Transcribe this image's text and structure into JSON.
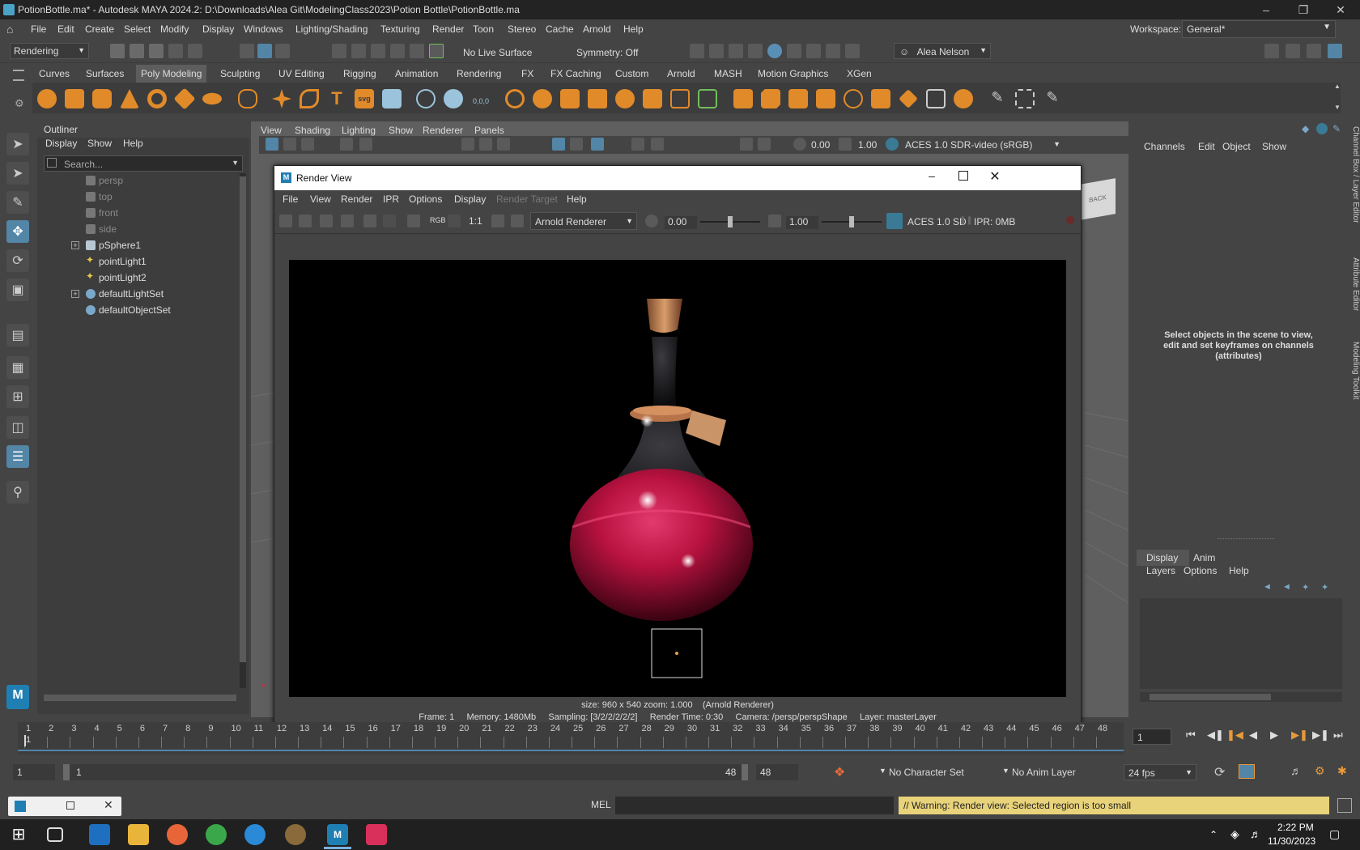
{
  "window": {
    "title": "PotionBottle.ma* - Autodesk MAYA 2024.2: D:\\Downloads\\Alea Git\\ModelingClass2023\\Potion Bottle\\PotionBottle.ma"
  },
  "menubar": {
    "items": [
      "File",
      "Edit",
      "Create",
      "Select",
      "Modify",
      "Display",
      "Windows",
      "Lighting/Shading",
      "Texturing",
      "Render",
      "Toon",
      "Stereo",
      "Cache",
      "Arnold",
      "Help"
    ],
    "workspace_label": "Workspace:",
    "workspace_value": "General*"
  },
  "statusline": {
    "menuset": "Rendering",
    "live_surface": "No Live Surface",
    "symmetry": "Symmetry: Off",
    "user": "Alea Nelson"
  },
  "shelf": {
    "tabs": [
      "Curves",
      "Surfaces",
      "Poly Modeling",
      "Sculpting",
      "UV Editing",
      "Rigging",
      "Animation",
      "Rendering",
      "FX",
      "FX Caching",
      "Custom",
      "Arnold",
      "MASH",
      "Motion Graphics",
      "XGen"
    ],
    "active_tab": "Poly Modeling"
  },
  "outliner": {
    "title": "Outliner",
    "menu": [
      "Display",
      "Show",
      "Help"
    ],
    "search_placeholder": "Search...",
    "items": [
      {
        "label": "persp",
        "dim": true
      },
      {
        "label": "top",
        "dim": true
      },
      {
        "label": "front",
        "dim": true
      },
      {
        "label": "side",
        "dim": true
      },
      {
        "label": "pSphere1",
        "dim": false
      },
      {
        "label": "pointLight1",
        "dim": false
      },
      {
        "label": "pointLight2",
        "dim": false
      },
      {
        "label": "defaultLightSet",
        "dim": false
      },
      {
        "label": "defaultObjectSet",
        "dim": false
      }
    ]
  },
  "viewport": {
    "menu": [
      "View",
      "Shading",
      "Lighting",
      "Show",
      "Renderer",
      "Panels"
    ],
    "exposure": "0.00",
    "gamma": "1.00",
    "colorspace": "ACES 1.0 SDR-video (sRGB)",
    "viewcube_label": "BACK"
  },
  "channelbox": {
    "menu": [
      "Channels",
      "Edit",
      "Object",
      "Show"
    ],
    "empty_message": "Select objects in the scene to view, edit and set keyframes on channels (attributes)"
  },
  "layers": {
    "tabs": [
      "Display",
      "Anim"
    ],
    "menu": [
      "Layers",
      "Options",
      "Help"
    ]
  },
  "rightstrip": {
    "labels": [
      "Channel Box / Layer Editor",
      "Attribute Editor",
      "Modeling Toolkit"
    ]
  },
  "renderview": {
    "title": "Render View",
    "menu": [
      "File",
      "View",
      "Render",
      "IPR",
      "Options",
      "Display",
      "Render Target",
      "Help"
    ],
    "rgb_label": "RGB",
    "ratio_label": "1:1",
    "renderer": "Arnold Renderer",
    "exposure": "0.00",
    "gamma": "1.00",
    "colorspace": "ACES 1.0 SD",
    "ipr": "IPR: 0MB",
    "size_line": "size: 960 x 540 zoom: 1.000    (Arnold Renderer)",
    "info_line": "Frame: 1     Memory: 1480Mb     Sampling: [3/2/2/2/2/2]     Render Time: 0:30     Camera: /persp/perspShape     Layer: masterLayer"
  },
  "timeslider": {
    "ticks": [
      "1",
      "2",
      "3",
      "4",
      "5",
      "6",
      "7",
      "8",
      "9",
      "10",
      "11",
      "12",
      "13",
      "14",
      "15",
      "16",
      "17",
      "18",
      "19",
      "20",
      "21",
      "22",
      "23",
      "24",
      "25",
      "26",
      "27",
      "28",
      "29",
      "30",
      "31",
      "32",
      "33",
      "34",
      "35",
      "36",
      "37",
      "38",
      "39",
      "40",
      "41",
      "42",
      "43",
      "44",
      "45",
      "46",
      "47",
      "48"
    ],
    "current_frame_marker": "1",
    "current_frame_field": "1"
  },
  "rangebar": {
    "start": "1",
    "range_start": "1",
    "range_end": "48",
    "end": "48",
    "character_set": "No Character Set",
    "anim_layer": "No Anim Layer",
    "fps": "24 fps"
  },
  "cmdline": {
    "lang": "MEL",
    "warning": "// Warning: Render view: Selected region is too small"
  },
  "taskbar": {
    "time": "2:22 PM",
    "date": "11/30/2023"
  },
  "colors": {
    "accent": "#5285a6",
    "liquid": "#c2144a",
    "warning_bg": "#e8d27a"
  }
}
